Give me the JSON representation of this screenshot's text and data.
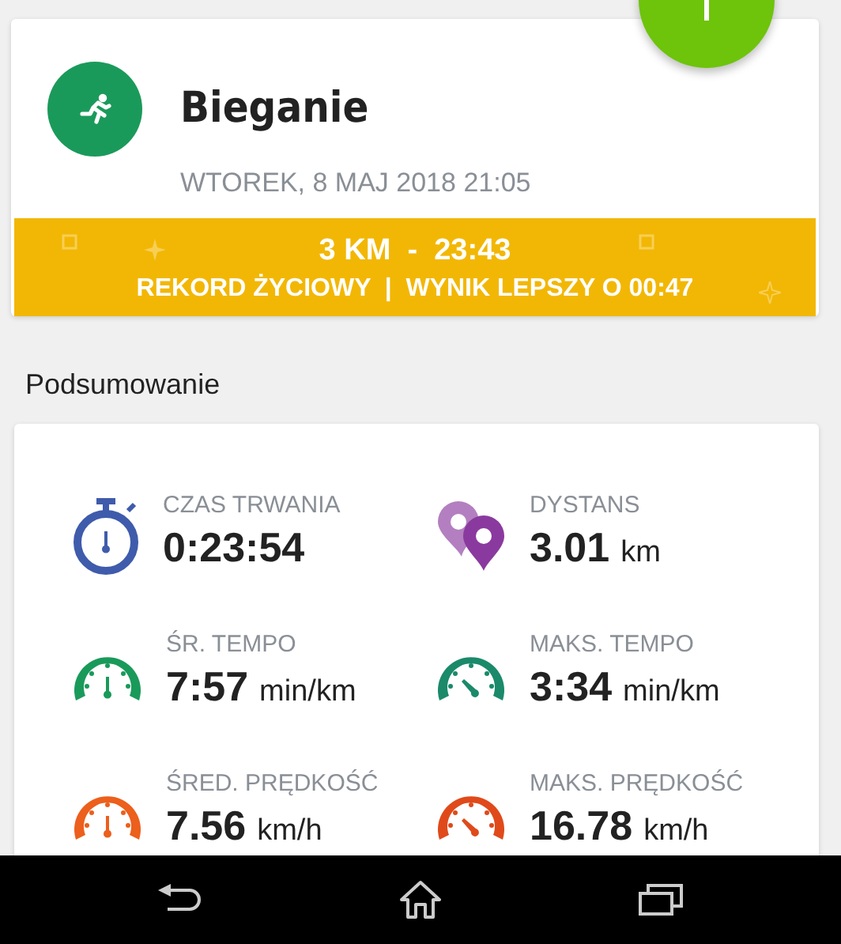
{
  "activity": {
    "title": "Bieganie",
    "date": "WTOREK, 8 MAJ 2018 21:05"
  },
  "record_banner": {
    "headline": "3 KM  -  23:43",
    "detail": "REKORD ŻYCIOWY  |  WYNIK LEPSZY O 00:47"
  },
  "summary": {
    "heading": "Podsumowanie",
    "metrics": [
      {
        "kind": "stopwatch",
        "color": "#3f5bab",
        "label": "CZAS TRWANIA",
        "value": "0:23:54"
      },
      {
        "kind": "pin",
        "color": "#8a3a9e",
        "label": "DYSTANS",
        "value": "3.01",
        "unit": "km"
      },
      {
        "kind": "gauge-avg",
        "color": "#1a9a5a",
        "label": "ŚR. TEMPO",
        "value": "7:57",
        "unit": "min/km"
      },
      {
        "kind": "gauge-max",
        "color": "#1a8a6a",
        "label": "MAKS. TEMPO",
        "value": "3:34",
        "unit": "min/km"
      },
      {
        "kind": "gauge-avg",
        "color": "#ec5f1c",
        "label": "ŚRED. PRĘDKOŚĆ",
        "value": "7.56",
        "unit": "km/h"
      },
      {
        "kind": "gauge-max",
        "color": "#e04a1a",
        "label": "MAKS. PRĘDKOŚĆ",
        "value": "16.78",
        "unit": "km/h"
      }
    ]
  }
}
